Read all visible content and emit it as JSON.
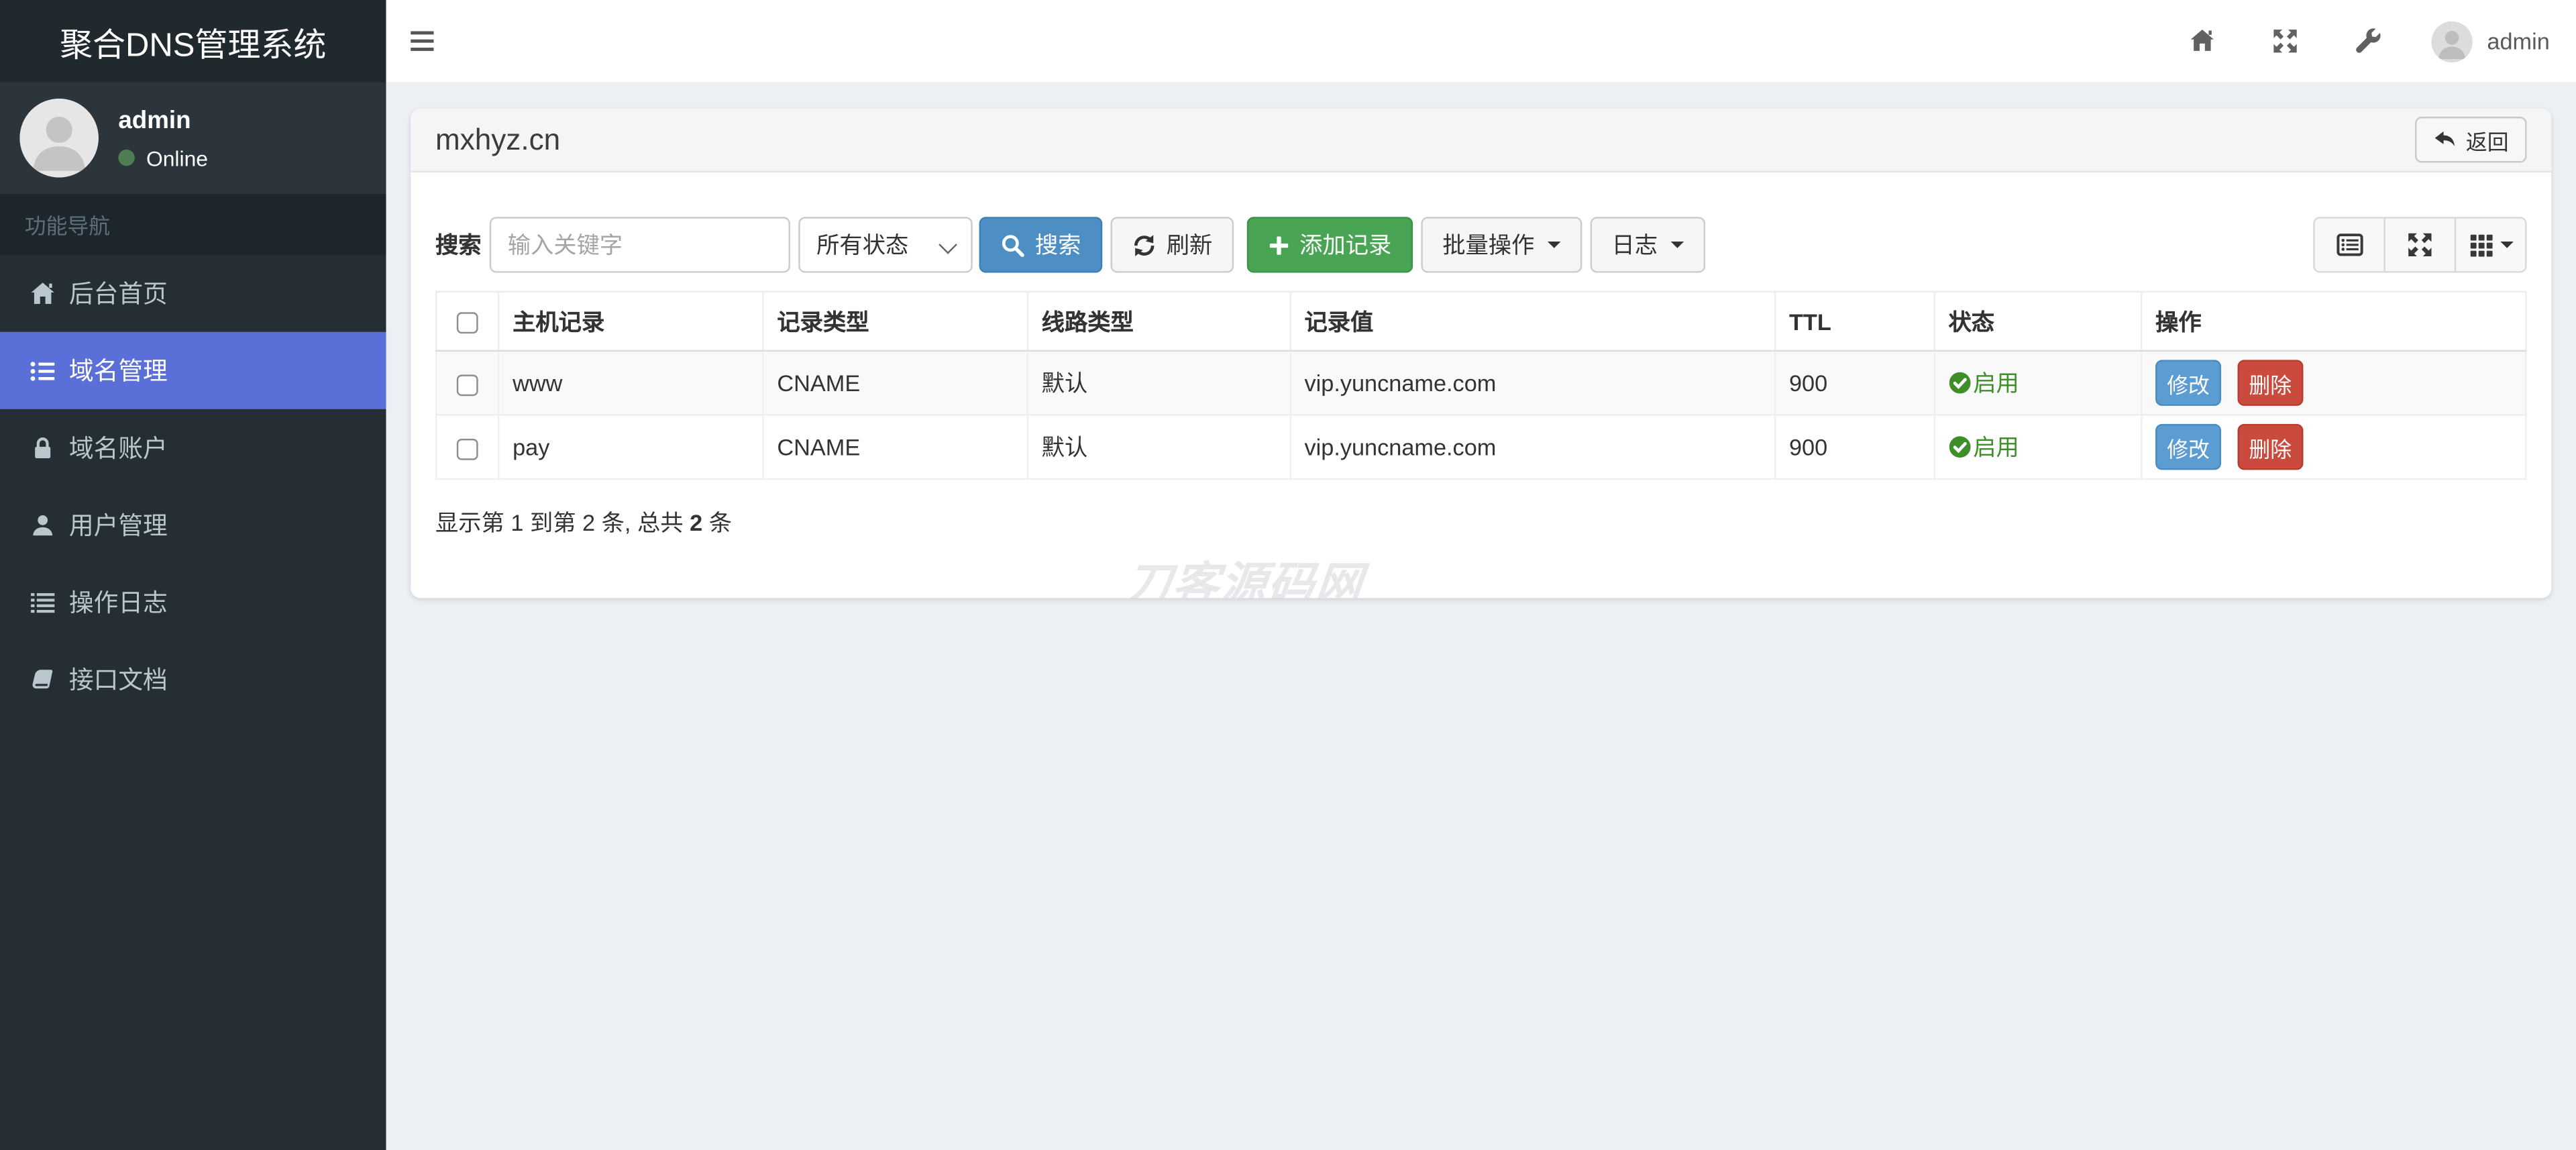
{
  "app": {
    "title": "聚合DNS管理系统"
  },
  "topbar": {
    "username": "admin",
    "icons": [
      "home-icon",
      "expand-icon",
      "wrench-icon"
    ]
  },
  "sidebar": {
    "user": {
      "name": "admin",
      "status": "Online"
    },
    "nav_header": "功能导航",
    "items": [
      {
        "label": "后台首页",
        "icon": "home-icon",
        "active": false
      },
      {
        "label": "域名管理",
        "icon": "list-icon",
        "active": true
      },
      {
        "label": "域名账户",
        "icon": "lock-icon",
        "active": false
      },
      {
        "label": "用户管理",
        "icon": "user-icon",
        "active": false
      },
      {
        "label": "操作日志",
        "icon": "log-list-icon",
        "active": false
      },
      {
        "label": "接口文档",
        "icon": "book-icon",
        "active": false
      }
    ]
  },
  "panel": {
    "title": "mxhyz.cn",
    "back_button": "返回"
  },
  "toolbar": {
    "search_label": "搜索",
    "search_placeholder": "输入关键字",
    "status_filter_value": "所有状态",
    "search_button": "搜索",
    "refresh_button": "刷新",
    "add_button": "添加记录",
    "batch_button": "批量操作",
    "log_button": "日志",
    "view_icons": [
      "list-alt-icon",
      "expand-icon",
      "th-grid-icon"
    ]
  },
  "table": {
    "columns": [
      "主机记录",
      "记录类型",
      "线路类型",
      "记录值",
      "TTL",
      "状态",
      "操作"
    ],
    "action_edit": "修改",
    "action_delete": "删除",
    "rows": [
      {
        "host": "www",
        "type": "CNAME",
        "line": "默认",
        "value": "vip.yuncname.com",
        "ttl": "900",
        "status": "启用"
      },
      {
        "host": "pay",
        "type": "CNAME",
        "line": "默认",
        "value": "vip.yuncname.com",
        "ttl": "900",
        "status": "启用"
      }
    ]
  },
  "footer": {
    "info_prefix": "显示第 1 到第 2 条, 总共",
    "info_total": "2",
    "info_suffix": "条"
  },
  "watermark": "刀客源码网",
  "colors": {
    "sidebar_bg": "#252e33",
    "sidebar_active": "#5b6fd8",
    "content_bg": "#ecf0f5",
    "primary_button": "#4d8fc4",
    "success_button": "#49a454",
    "danger_button": "#ca4a3d",
    "edit_button": "#5b9cd3",
    "status_enabled": "#3e8f29",
    "online_dot": "#4e7d52"
  }
}
